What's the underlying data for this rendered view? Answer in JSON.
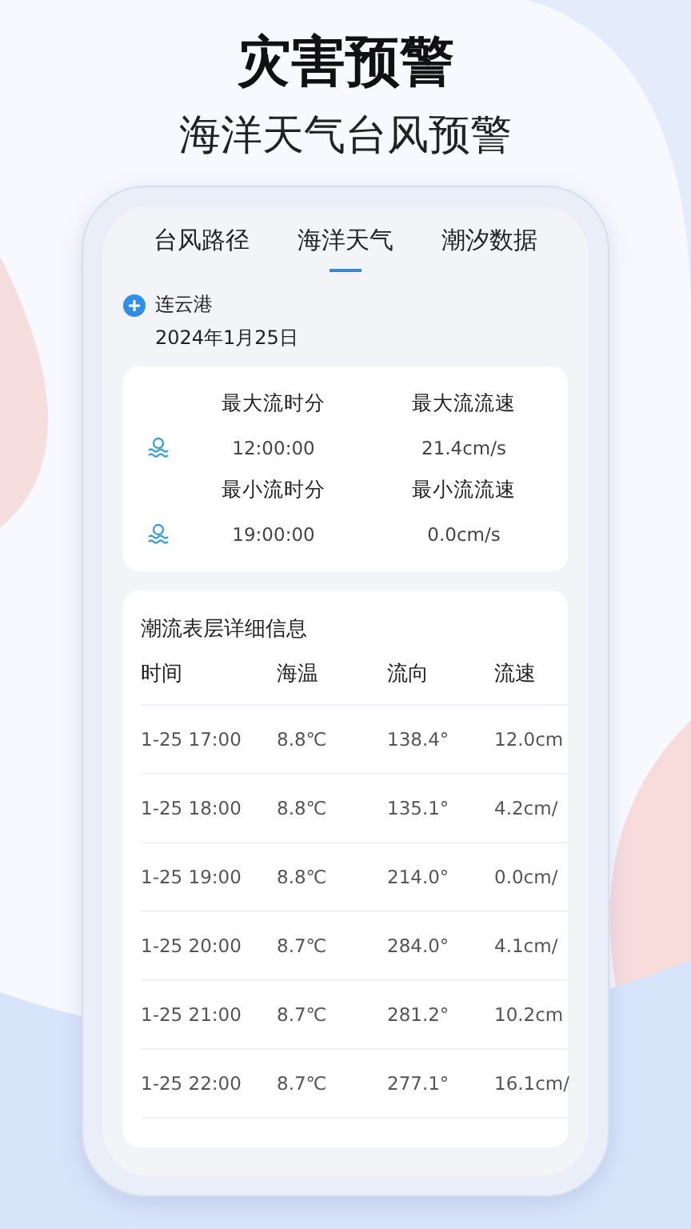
{
  "headline": "灾害预警",
  "subheadline": "海洋天气台风预警",
  "tabs": [
    {
      "label": "台风路径",
      "selected": false
    },
    {
      "label": "海洋天气",
      "selected": true
    },
    {
      "label": "潮汐数据",
      "selected": false
    }
  ],
  "location": {
    "name": "连云港",
    "date": "2024年1月25日"
  },
  "summary": [
    {
      "time_label": "最大流时分",
      "time": "12:00:00",
      "speed_label": "最大流流速",
      "speed": "21.4cm/s"
    },
    {
      "time_label": "最小流时分",
      "time": "19:00:00",
      "speed_label": "最小流流速",
      "speed": "0.0cm/s"
    }
  ],
  "table": {
    "title": "潮流表层详细信息",
    "columns": [
      "时间",
      "海温",
      "流向",
      "流速"
    ],
    "rows": [
      [
        "1-25 17:00",
        "8.8℃",
        "138.4°",
        "12.0cm"
      ],
      [
        "1-25 18:00",
        "8.8℃",
        "135.1°",
        "4.2cm/"
      ],
      [
        "1-25 19:00",
        "8.8℃",
        "214.0°",
        "0.0cm/"
      ],
      [
        "1-25 20:00",
        "8.7℃",
        "284.0°",
        "4.1cm/"
      ],
      [
        "1-25 21:00",
        "8.7℃",
        "281.2°",
        "10.2cm"
      ],
      [
        "1-25 22:00",
        "8.7℃",
        "277.1°",
        "16.1cm/"
      ]
    ]
  }
}
